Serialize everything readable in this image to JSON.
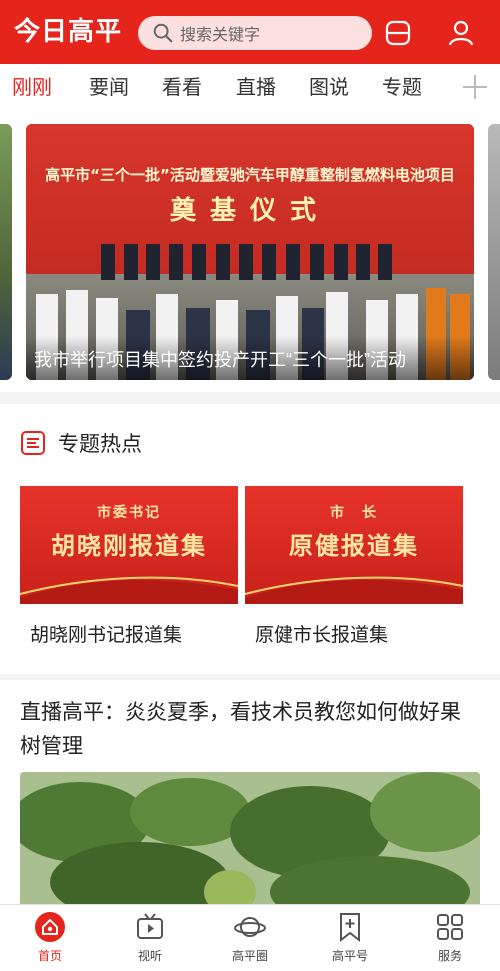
{
  "header": {
    "logo_text": "今日高平",
    "search_placeholder": "搜索关键字"
  },
  "tabs": [
    "刚刚",
    "要闻",
    "看看",
    "直播",
    "图说",
    "专题"
  ],
  "active_tab": "刚刚",
  "carousel": {
    "banner_line1": "高平市“三个一批”活动暨爱驰汽车甲醇重整制氢燃料电池项目",
    "banner_line2": "奠基仪式",
    "caption": "我市举行项目集中签约投产开工“三个一批”活动"
  },
  "special": {
    "title": "专题热点",
    "cards": [
      {
        "tag": "市委书记",
        "banner": "胡晓刚报道集",
        "label": "胡晓刚书记报道集"
      },
      {
        "tag": "市　长",
        "banner": "原健报道集",
        "label": "原健市长报道集"
      }
    ]
  },
  "article": {
    "title": "直播高平：炎炎夏季，看技术员教您如何做好果树管理"
  },
  "bottom_nav": [
    {
      "label": "首页",
      "icon": "home-icon",
      "active": true
    },
    {
      "label": "视听",
      "icon": "tv-icon",
      "active": false
    },
    {
      "label": "高平圈",
      "icon": "planet-icon",
      "active": false
    },
    {
      "label": "高平号",
      "icon": "bookmark-plus-icon",
      "active": false
    },
    {
      "label": "服务",
      "icon": "grid-icon",
      "active": false
    }
  ],
  "colors": {
    "brand_red": "#e5251c",
    "banner_gold": "#ffe7a3"
  }
}
